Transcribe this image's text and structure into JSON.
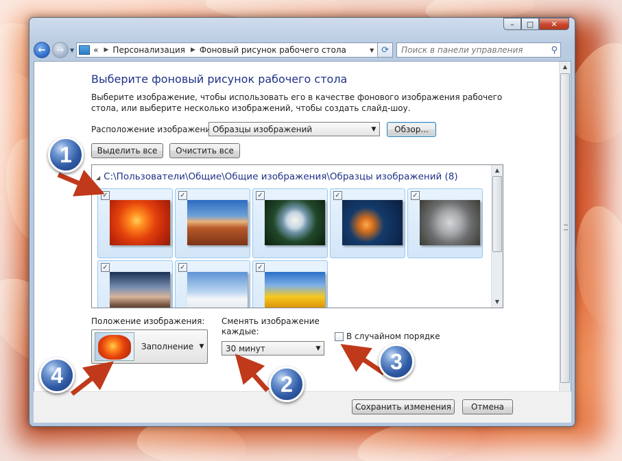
{
  "nav": {
    "breadcrumb": [
      "Персонализация",
      "Фоновый рисунок рабочего стола"
    ],
    "chevrons": "«",
    "search_placeholder": "Поиск в панели управления"
  },
  "page": {
    "title": "Выберите фоновый рисунок рабочего стола",
    "description": "Выберите изображение, чтобы использовать его в качестве фонового изображения рабочего стола, или выберите несколько изображений, чтобы создать слайд-шоу.",
    "location_label": "Расположение изображения:",
    "location_value": "Образцы изображений",
    "browse_label": "Обзор...",
    "select_all_label": "Выделить все",
    "clear_all_label": "Очистить все"
  },
  "gallery": {
    "header": "C:\\Пользователи\\Общие\\Общие изображения\\Образцы изображений (8)",
    "images": [
      {
        "name": "chrysanthemum",
        "checked": true
      },
      {
        "name": "desert",
        "checked": true
      },
      {
        "name": "hydrangeas",
        "checked": true
      },
      {
        "name": "jellyfish",
        "checked": true
      },
      {
        "name": "koala",
        "checked": true
      },
      {
        "name": "lighthouse",
        "checked": true
      },
      {
        "name": "penguins",
        "checked": true
      },
      {
        "name": "tulips",
        "checked": true
      }
    ]
  },
  "options": {
    "position_label": "Положение изображения:",
    "position_value": "Заполнение",
    "change_label": "Сменять изображение каждые:",
    "change_value": "30 минут",
    "random_label": "В случайном порядке",
    "random_checked": false
  },
  "footer": {
    "save_label": "Сохранить изменения",
    "cancel_label": "Отмена"
  },
  "badges": [
    "1",
    "2",
    "3",
    "4"
  ],
  "colors": {
    "title": "#1e3287",
    "arrow": "#c0391b",
    "badge": "#2f5aa4"
  }
}
